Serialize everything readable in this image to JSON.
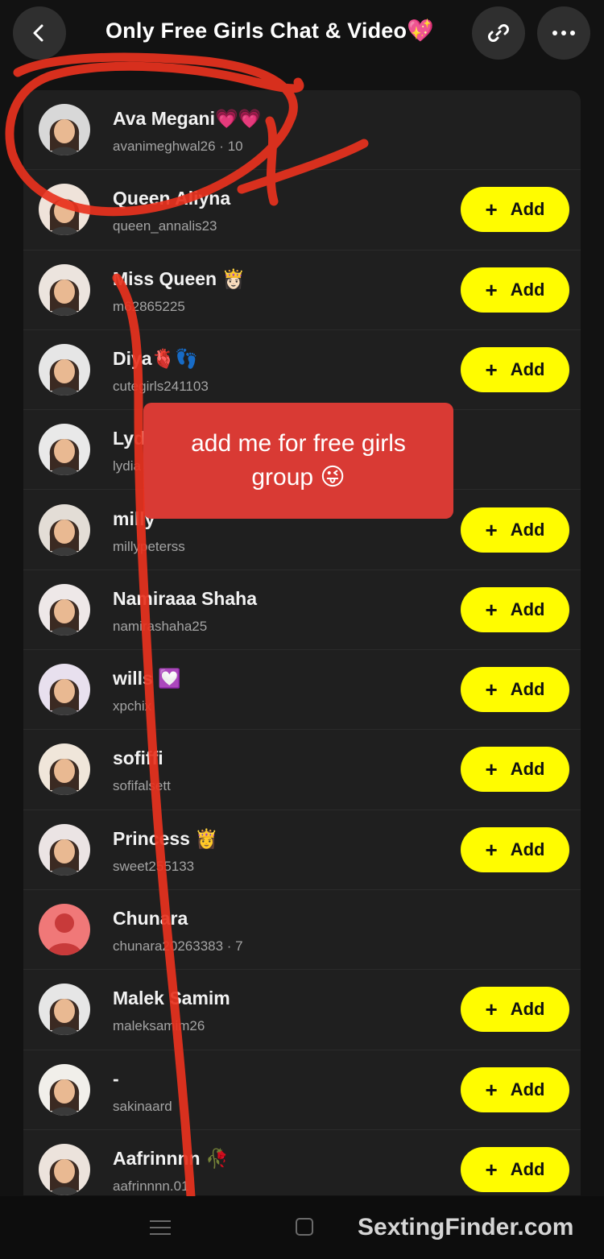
{
  "header": {
    "title": "Only Free Girls Chat & Video💖",
    "back_icon": "chevron-left-icon",
    "link_icon": "link-icon",
    "more_icon": "more-horizontal-icon"
  },
  "members": [
    {
      "name": "Ava Megani💗💗",
      "username": "avanimeghwal26 · 10",
      "has_add": false
    },
    {
      "name": "Queen Aliyna",
      "username": "queen_annalis23",
      "has_add": true
    },
    {
      "name": "Miss Queen 👸🏻",
      "username": "m62865225",
      "has_add": true
    },
    {
      "name": "Diya🫀👣",
      "username": "cutegirls241103",
      "has_add": true
    },
    {
      "name": "Lyd",
      "username": "lydia",
      "has_add": false
    },
    {
      "name": "milly",
      "username": "millypeterss",
      "has_add": true
    },
    {
      "name": "Namiraaa Shaha",
      "username": "namirashaha25",
      "has_add": true
    },
    {
      "name": "wills 💟",
      "username": "xpchix",
      "has_add": true
    },
    {
      "name": "sofiffi",
      "username": "sofifalsett",
      "has_add": true
    },
    {
      "name": "Princess 👸",
      "username": "sweet255133",
      "has_add": true
    },
    {
      "name": "Chunara",
      "username": "chunara20263383 · 7",
      "has_add": false
    },
    {
      "name": "Malek Samim",
      "username": "maleksamim26",
      "has_add": true
    },
    {
      "name": "-",
      "username": "sakinaard",
      "has_add": true
    },
    {
      "name": "Aafrinnnn 🥀",
      "username": "aafrinnnn.01",
      "has_add": true
    }
  ],
  "add_label": "Add",
  "add_plus": "+",
  "popup": {
    "text": "add me for free girls group 😜"
  },
  "watermark": "SextingFinder.com",
  "colors": {
    "add_button": "#fffc00",
    "popup": "#d93a34",
    "scribble": "#e8321e"
  }
}
